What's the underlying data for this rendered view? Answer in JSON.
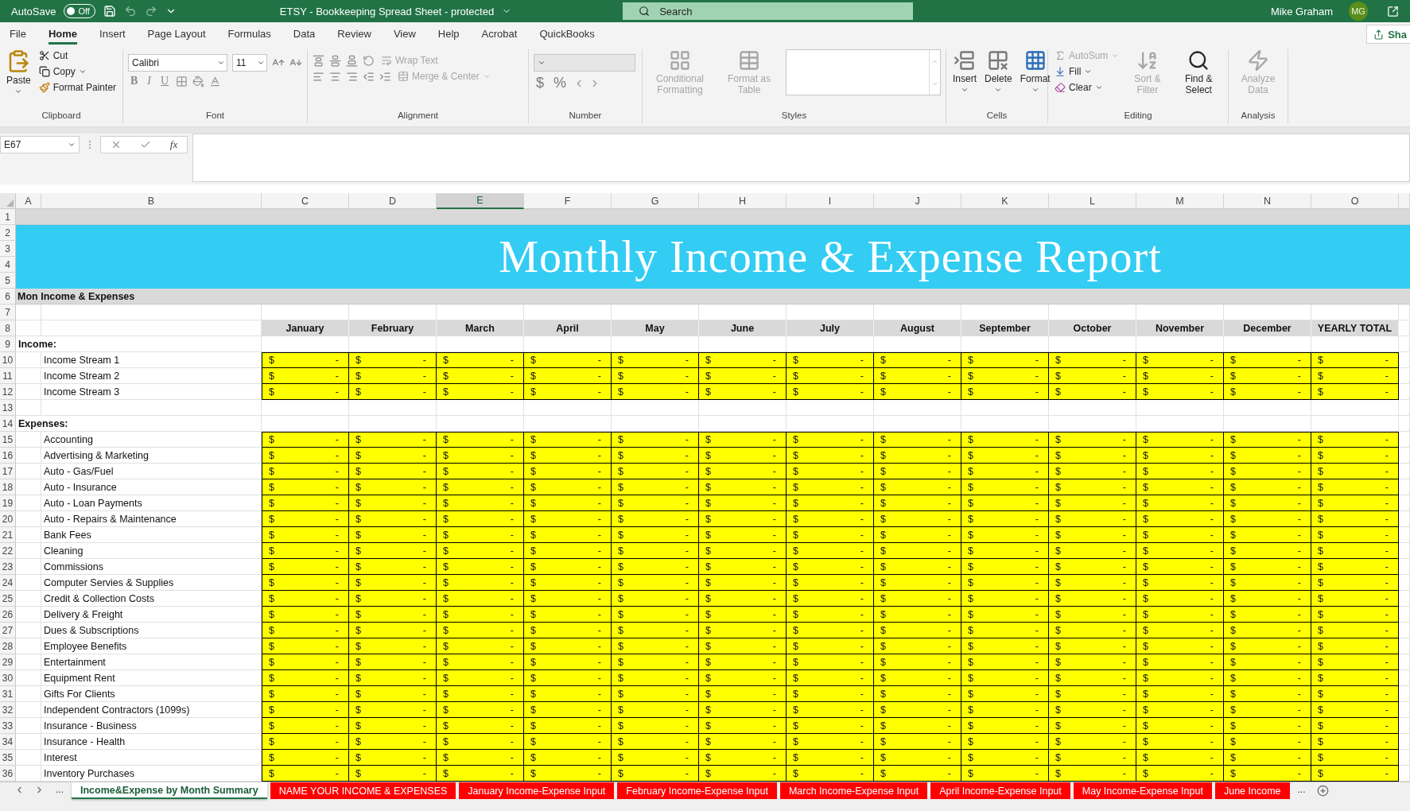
{
  "title_bar": {
    "autosave": {
      "label": "AutoSave",
      "toggle": "Off",
      "on": false
    },
    "title": "ETSY - Bookkeeping Spread Sheet - protected",
    "search": {
      "placeholder": "Search"
    },
    "user": "Mike Graham",
    "initials": "MG"
  },
  "menu": {
    "tabs": [
      {
        "label": "File",
        "selected": false
      },
      {
        "label": "Home",
        "selected": true
      },
      {
        "label": "Insert",
        "selected": false
      },
      {
        "label": "Page Layout",
        "selected": false
      },
      {
        "label": "Formulas",
        "selected": false
      },
      {
        "label": "Data",
        "selected": false
      },
      {
        "label": "Review",
        "selected": false
      },
      {
        "label": "View",
        "selected": false
      },
      {
        "label": "Help",
        "selected": false
      },
      {
        "label": "Acrobat",
        "selected": false
      },
      {
        "label": "QuickBooks",
        "selected": false
      }
    ],
    "share": "Sha"
  },
  "ribbon": {
    "groups": [
      {
        "kind": "clipboard",
        "label": "Clipboard",
        "paste": "Paste",
        "items": [
          {
            "label": "Cut",
            "disabled": false
          },
          {
            "label": "Copy",
            "disabled": false
          },
          {
            "label": "Format Painter",
            "disabled": false
          }
        ]
      },
      {
        "kind": "font",
        "label": "Font",
        "font_name": "Calibri",
        "font_size": "11",
        "styles": [
          "B",
          "I",
          "U"
        ]
      },
      {
        "kind": "alignment",
        "label": "Alignment",
        "items": [
          {
            "label": "Wrap Text",
            "disabled": true
          },
          {
            "label": "Merge & Center",
            "disabled": true
          }
        ]
      },
      {
        "kind": "number",
        "label": "Number",
        "symbols": [
          "$",
          "%"
        ]
      },
      {
        "kind": "styles",
        "label": "Styles",
        "items": [
          {
            "label": "Conditional Formatting",
            "disabled": true
          },
          {
            "label": "Format as Table",
            "disabled": true
          }
        ]
      },
      {
        "kind": "cells",
        "label": "Cells",
        "items": [
          {
            "label": "Insert",
            "disabled": false
          },
          {
            "label": "Delete",
            "disabled": false
          },
          {
            "label": "Format",
            "disabled": false
          }
        ]
      },
      {
        "kind": "editing",
        "label": "Editing",
        "items": [
          {
            "label": "AutoSum",
            "disabled": true
          },
          {
            "label": "Fill",
            "disabled": false
          },
          {
            "label": "Clear",
            "disabled": false
          }
        ],
        "large": [
          {
            "label": "Sort & Filter",
            "disabled": true
          },
          {
            "label": "Find & Select",
            "disabled": false
          }
        ]
      },
      {
        "kind": "analysis",
        "label": "Analysis",
        "items": [
          {
            "label": "Analyze Data",
            "disabled": true
          }
        ]
      }
    ]
  },
  "formula_bar": {
    "name_box": "E67",
    "fx": "fx"
  },
  "columns": [
    {
      "letter": "A",
      "selected": false
    },
    {
      "letter": "B",
      "selected": false
    },
    {
      "letter": "C",
      "selected": false
    },
    {
      "letter": "D",
      "selected": false
    },
    {
      "letter": "E",
      "selected": true
    },
    {
      "letter": "F",
      "selected": false
    },
    {
      "letter": "G",
      "selected": false
    },
    {
      "letter": "H",
      "selected": false
    },
    {
      "letter": "I",
      "selected": false
    },
    {
      "letter": "J",
      "selected": false
    },
    {
      "letter": "K",
      "selected": false
    },
    {
      "letter": "L",
      "selected": false
    },
    {
      "letter": "M",
      "selected": false
    },
    {
      "letter": "N",
      "selected": false
    },
    {
      "letter": "O",
      "selected": false
    }
  ],
  "rows": [
    {
      "kind": "band",
      "number": "1"
    },
    {
      "kind": "banner",
      "numbers": [
        "2",
        "3",
        "4",
        "5"
      ],
      "title": "Monthly Income & Expense Report"
    },
    {
      "kind": "section",
      "number": "6",
      "label": "Mon Income & Expenses"
    },
    {
      "kind": "blank",
      "number": "7"
    },
    {
      "kind": "header",
      "number": "8",
      "months": [
        "January",
        "February",
        "March",
        "April",
        "May",
        "June",
        "July",
        "August",
        "September",
        "October",
        "November",
        "December",
        "YEARLY TOTAL"
      ]
    },
    {
      "kind": "group",
      "number": "9",
      "label": "Income:"
    },
    {
      "kind": "data",
      "number": "10",
      "label": "Income Stream 1",
      "cells": [
        [
          "$",
          "-"
        ],
        [
          "$",
          "-"
        ],
        [
          "$",
          "-"
        ],
        [
          "$",
          "-"
        ],
        [
          "$",
          "-"
        ],
        [
          "$",
          "-"
        ],
        [
          "$",
          "-"
        ],
        [
          "$",
          "-"
        ],
        [
          "$",
          "-"
        ],
        [
          "$",
          "-"
        ],
        [
          "$",
          "-"
        ],
        [
          "$",
          "-"
        ],
        [
          "$",
          "-"
        ]
      ]
    },
    {
      "kind": "data",
      "number": "11",
      "label": "Income Stream 2",
      "cells": [
        [
          "$",
          "-"
        ],
        [
          "$",
          "-"
        ],
        [
          "$",
          "-"
        ],
        [
          "$",
          "-"
        ],
        [
          "$",
          "-"
        ],
        [
          "$",
          "-"
        ],
        [
          "$",
          "-"
        ],
        [
          "$",
          "-"
        ],
        [
          "$",
          "-"
        ],
        [
          "$",
          "-"
        ],
        [
          "$",
          "-"
        ],
        [
          "$",
          "-"
        ],
        [
          "$",
          "-"
        ]
      ]
    },
    {
      "kind": "data",
      "number": "12",
      "label": "Income Stream 3",
      "cells": [
        [
          "$",
          "-"
        ],
        [
          "$",
          "-"
        ],
        [
          "$",
          "-"
        ],
        [
          "$",
          "-"
        ],
        [
          "$",
          "-"
        ],
        [
          "$",
          "-"
        ],
        [
          "$",
          "-"
        ],
        [
          "$",
          "-"
        ],
        [
          "$",
          "-"
        ],
        [
          "$",
          "-"
        ],
        [
          "$",
          "-"
        ],
        [
          "$",
          "-"
        ],
        [
          "$",
          "-"
        ]
      ]
    },
    {
      "kind": "blank",
      "number": "13"
    },
    {
      "kind": "group",
      "number": "14",
      "label": "Expenses:"
    },
    {
      "kind": "data",
      "number": "15",
      "label": "Accounting",
      "cells": [
        [
          "$",
          "-"
        ],
        [
          "$",
          "-"
        ],
        [
          "$",
          "-"
        ],
        [
          "$",
          "-"
        ],
        [
          "$",
          "-"
        ],
        [
          "$",
          "-"
        ],
        [
          "$",
          "-"
        ],
        [
          "$",
          "-"
        ],
        [
          "$",
          "-"
        ],
        [
          "$",
          "-"
        ],
        [
          "$",
          "-"
        ],
        [
          "$",
          "-"
        ],
        [
          "$",
          "-"
        ]
      ]
    },
    {
      "kind": "data",
      "number": "16",
      "label": "Advertising & Marketing",
      "cells": [
        [
          "$",
          "-"
        ],
        [
          "$",
          "-"
        ],
        [
          "$",
          "-"
        ],
        [
          "$",
          "-"
        ],
        [
          "$",
          "-"
        ],
        [
          "$",
          "-"
        ],
        [
          "$",
          "-"
        ],
        [
          "$",
          "-"
        ],
        [
          "$",
          "-"
        ],
        [
          "$",
          "-"
        ],
        [
          "$",
          "-"
        ],
        [
          "$",
          "-"
        ],
        [
          "$",
          "-"
        ]
      ]
    },
    {
      "kind": "data",
      "number": "17",
      "label": "Auto - Gas/Fuel",
      "cells": [
        [
          "$",
          "-"
        ],
        [
          "$",
          "-"
        ],
        [
          "$",
          "-"
        ],
        [
          "$",
          "-"
        ],
        [
          "$",
          "-"
        ],
        [
          "$",
          "-"
        ],
        [
          "$",
          "-"
        ],
        [
          "$",
          "-"
        ],
        [
          "$",
          "-"
        ],
        [
          "$",
          "-"
        ],
        [
          "$",
          "-"
        ],
        [
          "$",
          "-"
        ],
        [
          "$",
          "-"
        ]
      ]
    },
    {
      "kind": "data",
      "number": "18",
      "label": "Auto - Insurance",
      "cells": [
        [
          "$",
          "-"
        ],
        [
          "$",
          "-"
        ],
        [
          "$",
          "-"
        ],
        [
          "$",
          "-"
        ],
        [
          "$",
          "-"
        ],
        [
          "$",
          "-"
        ],
        [
          "$",
          "-"
        ],
        [
          "$",
          "-"
        ],
        [
          "$",
          "-"
        ],
        [
          "$",
          "-"
        ],
        [
          "$",
          "-"
        ],
        [
          "$",
          "-"
        ],
        [
          "$",
          "-"
        ]
      ]
    },
    {
      "kind": "data",
      "number": "19",
      "label": "Auto - Loan Payments",
      "cells": [
        [
          "$",
          "-"
        ],
        [
          "$",
          "-"
        ],
        [
          "$",
          "-"
        ],
        [
          "$",
          "-"
        ],
        [
          "$",
          "-"
        ],
        [
          "$",
          "-"
        ],
        [
          "$",
          "-"
        ],
        [
          "$",
          "-"
        ],
        [
          "$",
          "-"
        ],
        [
          "$",
          "-"
        ],
        [
          "$",
          "-"
        ],
        [
          "$",
          "-"
        ],
        [
          "$",
          "-"
        ]
      ]
    },
    {
      "kind": "data",
      "number": "20",
      "label": "Auto - Repairs & Maintenance",
      "cells": [
        [
          "$",
          "-"
        ],
        [
          "$",
          "-"
        ],
        [
          "$",
          "-"
        ],
        [
          "$",
          "-"
        ],
        [
          "$",
          "-"
        ],
        [
          "$",
          "-"
        ],
        [
          "$",
          "-"
        ],
        [
          "$",
          "-"
        ],
        [
          "$",
          "-"
        ],
        [
          "$",
          "-"
        ],
        [
          "$",
          "-"
        ],
        [
          "$",
          "-"
        ],
        [
          "$",
          "-"
        ]
      ]
    },
    {
      "kind": "data",
      "number": "21",
      "label": "Bank Fees",
      "cells": [
        [
          "$",
          "-"
        ],
        [
          "$",
          "-"
        ],
        [
          "$",
          "-"
        ],
        [
          "$",
          "-"
        ],
        [
          "$",
          "-"
        ],
        [
          "$",
          "-"
        ],
        [
          "$",
          "-"
        ],
        [
          "$",
          "-"
        ],
        [
          "$",
          "-"
        ],
        [
          "$",
          "-"
        ],
        [
          "$",
          "-"
        ],
        [
          "$",
          "-"
        ],
        [
          "$",
          "-"
        ]
      ]
    },
    {
      "kind": "data",
      "number": "22",
      "label": "Cleaning",
      "cells": [
        [
          "$",
          "-"
        ],
        [
          "$",
          "-"
        ],
        [
          "$",
          "-"
        ],
        [
          "$",
          "-"
        ],
        [
          "$",
          "-"
        ],
        [
          "$",
          "-"
        ],
        [
          "$",
          "-"
        ],
        [
          "$",
          "-"
        ],
        [
          "$",
          "-"
        ],
        [
          "$",
          "-"
        ],
        [
          "$",
          "-"
        ],
        [
          "$",
          "-"
        ],
        [
          "$",
          "-"
        ]
      ]
    },
    {
      "kind": "data",
      "number": "23",
      "label": "Commissions",
      "cells": [
        [
          "$",
          "-"
        ],
        [
          "$",
          "-"
        ],
        [
          "$",
          "-"
        ],
        [
          "$",
          "-"
        ],
        [
          "$",
          "-"
        ],
        [
          "$",
          "-"
        ],
        [
          "$",
          "-"
        ],
        [
          "$",
          "-"
        ],
        [
          "$",
          "-"
        ],
        [
          "$",
          "-"
        ],
        [
          "$",
          "-"
        ],
        [
          "$",
          "-"
        ],
        [
          "$",
          "-"
        ]
      ]
    },
    {
      "kind": "data",
      "number": "24",
      "label": "Computer Servies & Supplies",
      "cells": [
        [
          "$",
          "-"
        ],
        [
          "$",
          "-"
        ],
        [
          "$",
          "-"
        ],
        [
          "$",
          "-"
        ],
        [
          "$",
          "-"
        ],
        [
          "$",
          "-"
        ],
        [
          "$",
          "-"
        ],
        [
          "$",
          "-"
        ],
        [
          "$",
          "-"
        ],
        [
          "$",
          "-"
        ],
        [
          "$",
          "-"
        ],
        [
          "$",
          "-"
        ],
        [
          "$",
          "-"
        ]
      ]
    },
    {
      "kind": "data",
      "number": "25",
      "label": "Credit & Collection Costs",
      "cells": [
        [
          "$",
          "-"
        ],
        [
          "$",
          "-"
        ],
        [
          "$",
          "-"
        ],
        [
          "$",
          "-"
        ],
        [
          "$",
          "-"
        ],
        [
          "$",
          "-"
        ],
        [
          "$",
          "-"
        ],
        [
          "$",
          "-"
        ],
        [
          "$",
          "-"
        ],
        [
          "$",
          "-"
        ],
        [
          "$",
          "-"
        ],
        [
          "$",
          "-"
        ],
        [
          "$",
          "-"
        ]
      ]
    },
    {
      "kind": "data",
      "number": "26",
      "label": "Delivery & Freight",
      "cells": [
        [
          "$",
          "-"
        ],
        [
          "$",
          "-"
        ],
        [
          "$",
          "-"
        ],
        [
          "$",
          "-"
        ],
        [
          "$",
          "-"
        ],
        [
          "$",
          "-"
        ],
        [
          "$",
          "-"
        ],
        [
          "$",
          "-"
        ],
        [
          "$",
          "-"
        ],
        [
          "$",
          "-"
        ],
        [
          "$",
          "-"
        ],
        [
          "$",
          "-"
        ],
        [
          "$",
          "-"
        ]
      ]
    },
    {
      "kind": "data",
      "number": "27",
      "label": "Dues & Subscriptions",
      "cells": [
        [
          "$",
          "-"
        ],
        [
          "$",
          "-"
        ],
        [
          "$",
          "-"
        ],
        [
          "$",
          "-"
        ],
        [
          "$",
          "-"
        ],
        [
          "$",
          "-"
        ],
        [
          "$",
          "-"
        ],
        [
          "$",
          "-"
        ],
        [
          "$",
          "-"
        ],
        [
          "$",
          "-"
        ],
        [
          "$",
          "-"
        ],
        [
          "$",
          "-"
        ],
        [
          "$",
          "-"
        ]
      ]
    },
    {
      "kind": "data",
      "number": "28",
      "label": "Employee Benefits",
      "cells": [
        [
          "$",
          "-"
        ],
        [
          "$",
          "-"
        ],
        [
          "$",
          "-"
        ],
        [
          "$",
          "-"
        ],
        [
          "$",
          "-"
        ],
        [
          "$",
          "-"
        ],
        [
          "$",
          "-"
        ],
        [
          "$",
          "-"
        ],
        [
          "$",
          "-"
        ],
        [
          "$",
          "-"
        ],
        [
          "$",
          "-"
        ],
        [
          "$",
          "-"
        ],
        [
          "$",
          "-"
        ]
      ]
    },
    {
      "kind": "data",
      "number": "29",
      "label": "Entertainment",
      "cells": [
        [
          "$",
          "-"
        ],
        [
          "$",
          "-"
        ],
        [
          "$",
          "-"
        ],
        [
          "$",
          "-"
        ],
        [
          "$",
          "-"
        ],
        [
          "$",
          "-"
        ],
        [
          "$",
          "-"
        ],
        [
          "$",
          "-"
        ],
        [
          "$",
          "-"
        ],
        [
          "$",
          "-"
        ],
        [
          "$",
          "-"
        ],
        [
          "$",
          "-"
        ],
        [
          "$",
          "-"
        ]
      ]
    },
    {
      "kind": "data",
      "number": "30",
      "label": "Equipment Rent",
      "cells": [
        [
          "$",
          "-"
        ],
        [
          "$",
          "-"
        ],
        [
          "$",
          "-"
        ],
        [
          "$",
          "-"
        ],
        [
          "$",
          "-"
        ],
        [
          "$",
          "-"
        ],
        [
          "$",
          "-"
        ],
        [
          "$",
          "-"
        ],
        [
          "$",
          "-"
        ],
        [
          "$",
          "-"
        ],
        [
          "$",
          "-"
        ],
        [
          "$",
          "-"
        ],
        [
          "$",
          "-"
        ]
      ]
    },
    {
      "kind": "data",
      "number": "31",
      "label": "Gifts For Clients",
      "cells": [
        [
          "$",
          "-"
        ],
        [
          "$",
          "-"
        ],
        [
          "$",
          "-"
        ],
        [
          "$",
          "-"
        ],
        [
          "$",
          "-"
        ],
        [
          "$",
          "-"
        ],
        [
          "$",
          "-"
        ],
        [
          "$",
          "-"
        ],
        [
          "$",
          "-"
        ],
        [
          "$",
          "-"
        ],
        [
          "$",
          "-"
        ],
        [
          "$",
          "-"
        ],
        [
          "$",
          "-"
        ]
      ]
    },
    {
      "kind": "data",
      "number": "32",
      "label": "Independent Contractors (1099s)",
      "cells": [
        [
          "$",
          "-"
        ],
        [
          "$",
          "-"
        ],
        [
          "$",
          "-"
        ],
        [
          "$",
          "-"
        ],
        [
          "$",
          "-"
        ],
        [
          "$",
          "-"
        ],
        [
          "$",
          "-"
        ],
        [
          "$",
          "-"
        ],
        [
          "$",
          "-"
        ],
        [
          "$",
          "-"
        ],
        [
          "$",
          "-"
        ],
        [
          "$",
          "-"
        ],
        [
          "$",
          "-"
        ]
      ]
    },
    {
      "kind": "data",
      "number": "33",
      "label": "Insurance - Business",
      "cells": [
        [
          "$",
          "-"
        ],
        [
          "$",
          "-"
        ],
        [
          "$",
          "-"
        ],
        [
          "$",
          "-"
        ],
        [
          "$",
          "-"
        ],
        [
          "$",
          "-"
        ],
        [
          "$",
          "-"
        ],
        [
          "$",
          "-"
        ],
        [
          "$",
          "-"
        ],
        [
          "$",
          "-"
        ],
        [
          "$",
          "-"
        ],
        [
          "$",
          "-"
        ],
        [
          "$",
          "-"
        ]
      ]
    },
    {
      "kind": "data",
      "number": "34",
      "label": "Insurance - Health",
      "cells": [
        [
          "$",
          "-"
        ],
        [
          "$",
          "-"
        ],
        [
          "$",
          "-"
        ],
        [
          "$",
          "-"
        ],
        [
          "$",
          "-"
        ],
        [
          "$",
          "-"
        ],
        [
          "$",
          "-"
        ],
        [
          "$",
          "-"
        ],
        [
          "$",
          "-"
        ],
        [
          "$",
          "-"
        ],
        [
          "$",
          "-"
        ],
        [
          "$",
          "-"
        ],
        [
          "$",
          "-"
        ]
      ]
    },
    {
      "kind": "data",
      "number": "35",
      "label": "Interest",
      "cells": [
        [
          "$",
          "-"
        ],
        [
          "$",
          "-"
        ],
        [
          "$",
          "-"
        ],
        [
          "$",
          "-"
        ],
        [
          "$",
          "-"
        ],
        [
          "$",
          "-"
        ],
        [
          "$",
          "-"
        ],
        [
          "$",
          "-"
        ],
        [
          "$",
          "-"
        ],
        [
          "$",
          "-"
        ],
        [
          "$",
          "-"
        ],
        [
          "$",
          "-"
        ],
        [
          "$",
          "-"
        ]
      ]
    },
    {
      "kind": "data",
      "number": "36",
      "label": "Inventory Purchases",
      "cells": [
        [
          "$",
          "-"
        ],
        [
          "$",
          "-"
        ],
        [
          "$",
          "-"
        ],
        [
          "$",
          "-"
        ],
        [
          "$",
          "-"
        ],
        [
          "$",
          "-"
        ],
        [
          "$",
          "-"
        ],
        [
          "$",
          "-"
        ],
        [
          "$",
          "-"
        ],
        [
          "$",
          "-"
        ],
        [
          "$",
          "-"
        ],
        [
          "$",
          "-"
        ],
        [
          "$",
          "-"
        ]
      ]
    }
  ],
  "sheet_tabs": {
    "more_left": "...",
    "tabs": [
      {
        "label": "Income&Expense by Month Summary",
        "selected": true
      },
      {
        "label": "NAME YOUR INCOME & EXPENSES",
        "selected": false
      },
      {
        "label": "January Income-Expense Input",
        "selected": false
      },
      {
        "label": "February Income-Expense Input",
        "selected": false
      },
      {
        "label": "March Income-Expense Input",
        "selected": false
      },
      {
        "label": "April Income-Expense Input",
        "selected": false
      },
      {
        "label": "May Income-Expense Input",
        "selected": false
      },
      {
        "label": "June Income",
        "selected": false
      }
    ],
    "more_right": "..."
  }
}
